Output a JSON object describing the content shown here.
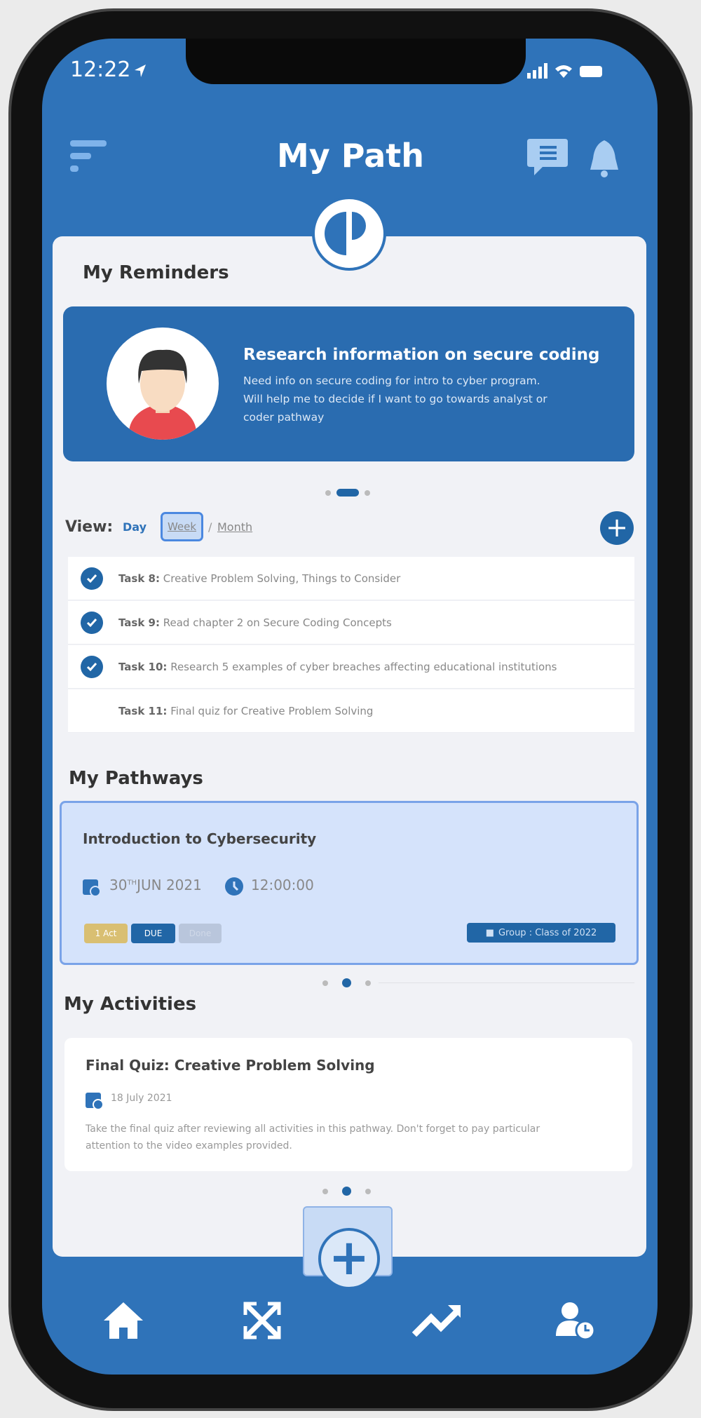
{
  "status": {
    "time": "12:22"
  },
  "header": {
    "title": "My Path",
    "menu_icon": "menu-icon",
    "chat_icon": "chat-icon",
    "bell_icon": "bell-icon"
  },
  "reminders": {
    "heading": "My Reminders",
    "title": "Research information on secure coding",
    "lines": [
      "Need info on secure coding for intro to cyber program.",
      "Will help me to decide if I want to go towards analyst or",
      "coder pathway"
    ]
  },
  "view": {
    "label": "View:",
    "day": "Day",
    "week": "Week",
    "sep": "/",
    "month": "Month",
    "selected": "Week"
  },
  "tasks": [
    {
      "num": "Task 8:",
      "text": "Creative Problem Solving, Things to Consider",
      "done": true
    },
    {
      "num": "Task 9:",
      "text": "Read chapter 2 on Secure Coding Concepts",
      "done": true
    },
    {
      "num": "Task 10:",
      "text": "Research 5 examples of cyber breaches affecting educational institutions",
      "done": true
    },
    {
      "num": "Task 11:",
      "text": "Final quiz for Creative Problem Solving",
      "done": false
    }
  ],
  "pathways": {
    "heading": "My Pathways",
    "title": "Introduction to Cybersecurity",
    "day": "30",
    "sup": "TH",
    "date": "JUN 2021",
    "time": "12:00:00",
    "badges": [
      "1 Act",
      "DUE",
      "Done"
    ],
    "group": "Group : Class of 2022"
  },
  "activities": {
    "heading": "My Activities",
    "title": "Final Quiz: Creative Problem Solving",
    "date": "18 July 2021",
    "lines": [
      "Take the final quiz after reviewing all activities in this pathway. Don't forget to pay particular",
      "attention to the video examples provided."
    ]
  },
  "colors": {
    "primary": "#2f73b9",
    "dark": "#2166a6",
    "gold": "#d9bf72",
    "card": "#d5e3fb"
  },
  "nav": [
    "home-icon",
    "expand-icon",
    "trending-icon",
    "user-clock-icon"
  ]
}
